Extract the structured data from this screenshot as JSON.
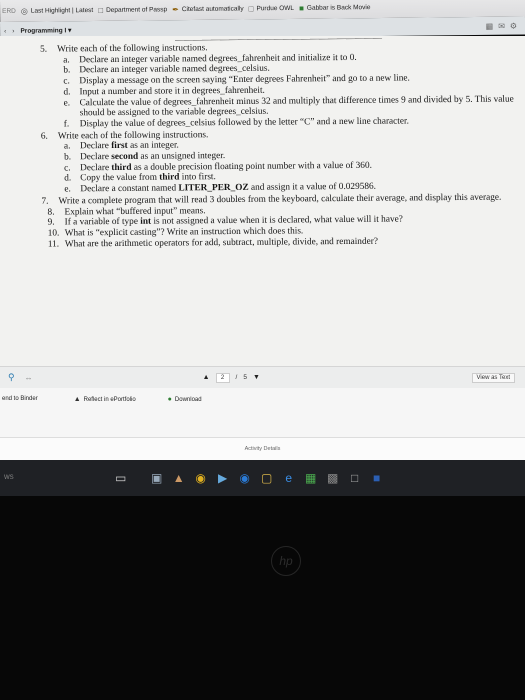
{
  "bookmarks": [
    {
      "label": "ERD",
      "icon": "bookmark-icon"
    },
    {
      "label": "Last Highlight | Latest",
      "icon": "globe-icon"
    },
    {
      "label": "Department of Passp",
      "icon": "page-icon"
    },
    {
      "label": "Citefast automatically",
      "icon": "citefast-icon"
    },
    {
      "label": "Purdue OWL",
      "icon": "page-icon"
    },
    {
      "label": "Gabbar is Back Movie",
      "icon": "gabbar-icon"
    }
  ],
  "tabbar": {
    "app_label": "Programming I"
  },
  "document": {
    "q5": {
      "number": "5.",
      "text": "Write each of the following instructions.",
      "items": [
        {
          "letter": "a.",
          "text": "Declare an integer variable named degrees_fahrenheit and initialize it to 0."
        },
        {
          "letter": "b.",
          "text": "Declare an integer variable named degrees_celsius."
        },
        {
          "letter": "c.",
          "text": "Display a message on the screen saying “Enter degrees Fahrenheit” and go to a new line."
        },
        {
          "letter": "d.",
          "text": "Input a number and store it in degrees_fahrenheit."
        },
        {
          "letter": "e.",
          "text": "Calculate the value of degrees_fahrenheit minus 32 and multiply that difference times 9 and divided by 5. This value should be assigned to the variable degrees_celsius."
        },
        {
          "letter": "f.",
          "text": "Display the value of degrees_celsius followed by the letter “C” and a new line character."
        }
      ]
    },
    "q6": {
      "number": "6.",
      "text": "Write each of the following instructions.",
      "items": [
        {
          "letter": "a.",
          "pre": "Declare ",
          "bold": "first",
          "post": " as an integer."
        },
        {
          "letter": "b.",
          "pre": "Declare ",
          "bold": "second",
          "post": " as an unsigned integer."
        },
        {
          "letter": "c.",
          "pre": "Declare ",
          "bold": "third",
          "post": " as a double precision floating point number with a value of 360."
        },
        {
          "letter": "d.",
          "pre": "Copy the value from ",
          "bold": "third",
          "post": " into first."
        },
        {
          "letter": "e.",
          "pre": "Declare a constant named ",
          "bold": "LITER_PER_OZ",
          "post": " and assign it a value of 0.029586."
        }
      ]
    },
    "q7": {
      "number": "7.",
      "text": "Write a complete program that will read 3 doubles from the keyboard, calculate their average, and display this average."
    },
    "q8": {
      "number": "8.",
      "text": "Explain what “buffered input” means."
    },
    "q9": {
      "number": "9.",
      "pre": "If a variable of type ",
      "bold": "int",
      "post": " is not assigned a value when it is declared, what value will it have?"
    },
    "q10": {
      "number": "10.",
      "text": "What is “explicit casting”? Write an instruction which does this."
    },
    "q11": {
      "number": "11.",
      "text": "What are the arithmetic operators for add, subtract, multiple, divide, and remainder?"
    }
  },
  "viewer": {
    "page_current": "2",
    "page_separator": "/",
    "page_total": "5",
    "view_as_text": "View as Text"
  },
  "actions": {
    "send_to_binder": "end to Binder",
    "reflect": "Reflect in ePortfolio",
    "download": "Download"
  },
  "footer": {
    "activity_details": "Activity Details"
  },
  "taskbar": {
    "ws_label": "WS"
  }
}
